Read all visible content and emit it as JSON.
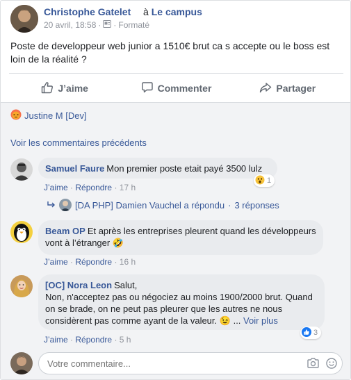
{
  "post": {
    "author": "Christophe Gatelet",
    "separator": "à",
    "group": "Le campus",
    "date": "20 avril, 18:58",
    "dot": "·",
    "format_label": "Formaté",
    "text": "Poste de developpeur web junior a 1510€ brut ca s accepte ou le boss est loin de la réalité ?"
  },
  "actions": {
    "like": "J’aime",
    "comment": "Commenter",
    "share": "Partager"
  },
  "reactors": {
    "name": "Justine M [Dev]",
    "icon": "angry-emoji-icon"
  },
  "previous_comments_link": "Voir les commentaires précédents",
  "comments": [
    {
      "author": "Samuel Faure",
      "text": "Mon premier poste etait payé 3500 lulz",
      "like_label": "J’aime",
      "reply_label": "Répondre",
      "time": "17 h",
      "reaction_count": "1",
      "reaction_icon": "wow-emoji-icon"
    },
    {
      "author": "Beam OP",
      "text": "Et après les entreprises pleurent quand les développeurs vont à l’étranger",
      "emoji": "🤣",
      "like_label": "J’aime",
      "reply_label": "Répondre",
      "time": "16 h"
    },
    {
      "author": "[OC] Nora Leon",
      "text_line1": "Salut,",
      "text_rest": "Non, n'acceptez pas ou négociez au moins 1900/2000 brut. Quand on se brade, on ne peut pas pleurer que les autres ne nous considèrent pas comme ayant de la valeur.",
      "emoji": "😉",
      "ellipsis": "...",
      "see_more": "Voir plus",
      "like_label": "J’aime",
      "reply_label": "Répondre",
      "time": "5 h",
      "reaction_count": "3",
      "reaction_icon": "like-icon"
    }
  ],
  "reply_thread": {
    "text": "[DA PHP] Damien Vauchel a répondu",
    "dot": "·",
    "count": "3 réponses"
  },
  "composer": {
    "placeholder": "Votre commentaire..."
  },
  "colors": {
    "link": "#385898",
    "muted": "#90949c",
    "bubble": "#e9ebee",
    "background": "#f2f3f5",
    "like_blue": "#1877f2"
  }
}
